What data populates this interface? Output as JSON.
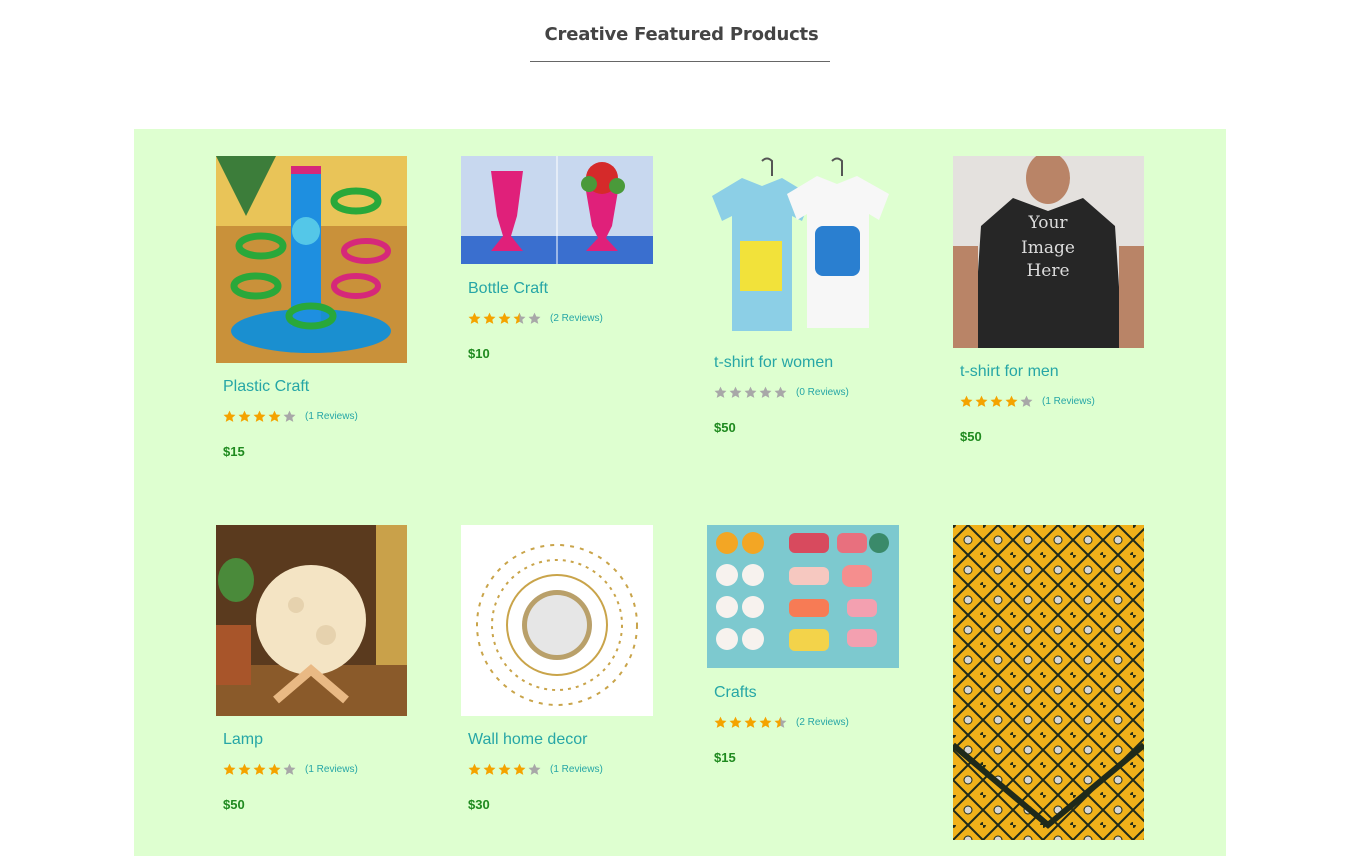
{
  "section": {
    "title": "Creative Featured Products"
  },
  "colors": {
    "band": "#deffd0",
    "star_filled": "#f4a300",
    "star_empty": "#a8a8a8",
    "name": "#26a6a6",
    "price": "#1f8a1f"
  },
  "products": [
    {
      "name": "Plastic Craft",
      "rating": 4,
      "reviews": "(1 Reviews)",
      "price": "$15",
      "image": "colorful-plastic-bottle-craft-stand"
    },
    {
      "name": "Bottle Craft",
      "rating": 3.5,
      "reviews": "(2 Reviews)",
      "price": "$10",
      "image": "pink-bottle-vases"
    },
    {
      "name": "t-shirt for women",
      "rating": 0,
      "reviews": "(0 Reviews)",
      "price": "$50",
      "image": "two-tshirts-on-hangers"
    },
    {
      "name": "t-shirt for men",
      "rating": 4,
      "reviews": "(1 Reviews)",
      "price": "$50",
      "image": "man-in-black-tshirt",
      "image_text": "Your Image Here"
    },
    {
      "name": "Lamp",
      "rating": 4,
      "reviews": "(1 Reviews)",
      "price": "$50",
      "image": "moon-lamp-on-wooden-stand"
    },
    {
      "name": "Wall home decor",
      "rating": 4,
      "reviews": "(1 Reviews)",
      "price": "$30",
      "image": "gold-sunburst-wall-mirror"
    },
    {
      "name": "Crafts",
      "rating": 4.5,
      "reviews": "(2 Reviews)",
      "price": "$15",
      "image": "crochet-sushi-crafts"
    },
    {
      "name": "",
      "rating": null,
      "reviews": "",
      "price": "",
      "image": "yellow-mirror-work-embroidery"
    }
  ]
}
